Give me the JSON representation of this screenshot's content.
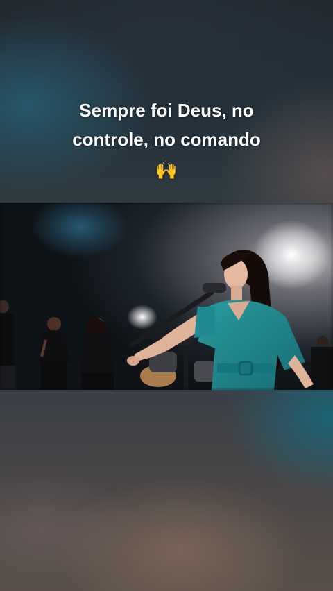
{
  "caption": {
    "line1": "Sempre foi Deus, no",
    "line2": "controle, no comando",
    "emoji": "🙌"
  },
  "video": {
    "scene": "worship-singer-performance",
    "accent_teal": "#1f8a8f"
  }
}
